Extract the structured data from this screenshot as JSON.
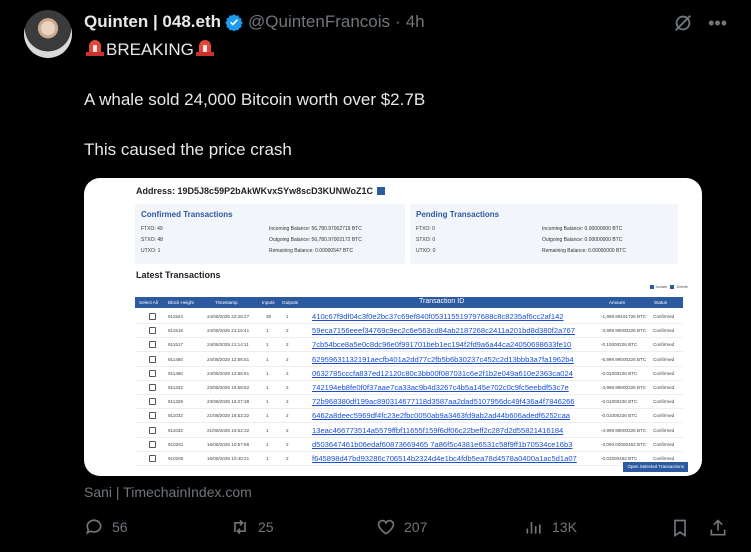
{
  "author": {
    "display_name": "Quinten | 048.eth",
    "handle": "@QuintenFrancois",
    "separator": "·",
    "time": "4h"
  },
  "tweet": {
    "breaking_label": "BREAKING",
    "line1": "A whale sold 24,000 Bitcoin worth over $2.7B",
    "line2": "This caused the price crash",
    "source_caption": "Sani | TimechainIndex.com"
  },
  "embed": {
    "address_label": "Address:",
    "address_value": "19D5J8c59P2bAkWKvxSYw8scD3KUNWoZ1C",
    "confirmed": {
      "title": "Confirmed Transactions",
      "ftxo_label": "FTXO: 49",
      "stxo_label": "STXO: 48",
      "utxo_label": "UTXO: 1",
      "incoming": "Incoming Balance: 56,780.97002719 BTC",
      "outgoing": "Outgoing Balance: 56,780.97002172 BTC",
      "remaining": "Remaining Balance: 0.00000547 BTC"
    },
    "pending": {
      "title": "Pending Transactions",
      "ftxo_label": "FTXO: 0",
      "stxo_label": "STXO: 0",
      "utxo_label": "UTXO: 0",
      "incoming": "Incoming Balance: 0.00000000 BTC",
      "outgoing": "Outgoing Balance: 0.00000000 BTC",
      "remaining": "Remaining Balance: 0.00000000 BTC"
    },
    "latest_title": "Latest Transactions",
    "legend": {
      "isolate": "Isolate",
      "delete": "Delete"
    },
    "columns": [
      "Select All",
      "Block Height",
      "Timestamp",
      "Inputs",
      "Outputs",
      "Transaction ID",
      "Amount",
      "Status"
    ],
    "rows": [
      {
        "block": "911524",
        "time": "24/08/2025 22:26:27",
        "inputs": "38",
        "outputs": "1",
        "txid": "410c67f9df04c3f0e2bc37c69ef840f053115519797688c8c8235af6cc2af142",
        "amount": "-1,968.99191726 BTC",
        "status": "Confirmed"
      },
      {
        "block": "911518",
        "time": "24/08/2025 21:15:41",
        "inputs": "1",
        "outputs": "2",
        "txid": "59eca7156eeef34769c9ec2c6e563cd84ab2187268c2411a201bd8d380f2a767",
        "amount": "-3,999.99000226 BTC",
        "status": "Confirmed"
      },
      {
        "block": "911517",
        "time": "24/08/2025 21:14:11",
        "inputs": "1",
        "outputs": "2",
        "txid": "7cb54bce8a5e0c8dc96e0f991701beb1ec194f2fd9a6a44ca24050698633fe10",
        "amount": "-0.10000226 BTC",
        "status": "Confirmed"
      },
      {
        "block": "911460",
        "time": "24/08/2025 12:56:51",
        "inputs": "1",
        "outputs": "2",
        "txid": "62959631132191aecfb401a2dd77c2fb5b6b30237c452c2d13bbb3a7fa1962b4",
        "amount": "-5,999.99000226 BTC",
        "status": "Confirmed"
      },
      {
        "block": "911460",
        "time": "24/08/2025 12:56:51",
        "inputs": "1",
        "outputs": "2",
        "txid": "0632785cccfa837ed12120c80c3bb00f087031c6e2f1b2e049a610e2363ca024",
        "amount": "-0.01000226 BTC",
        "status": "Confirmed"
      },
      {
        "block": "911332",
        "time": "23/08/2025 16:58:52",
        "inputs": "1",
        "outputs": "2",
        "txid": "742194eb8fe0f0f37aae7ca33ac9b4d3267c4b5a145e702c0c9fc5eebdf53c7e",
        "amount": "-3,999.99000226 BTC",
        "status": "Confirmed"
      },
      {
        "block": "911329",
        "time": "23/08/2025 16:27:38",
        "inputs": "1",
        "outputs": "2",
        "txid": "72b968380df199ac890314677118d3587aa2dad5107956dc49f436a4f7846266",
        "amount": "-0.01000226 BTC",
        "status": "Confirmed"
      },
      {
        "block": "911032",
        "time": "21/08/2025 16:52:32",
        "inputs": "1",
        "outputs": "2",
        "txid": "6462a8deec5969df4fc23e2fbc0050ab9a3463fd9ab2ad44b606adedf6252caa",
        "amount": "-0.01000226 BTC",
        "status": "Confirmed"
      },
      {
        "block": "911032",
        "time": "21/08/2025 16:52:32",
        "inputs": "1",
        "outputs": "2",
        "txid": "13eac466773514a5579ffbf11655f159f6df06c22beff2c287d2d55821416184",
        "amount": "-4,999.99000226 BTC",
        "status": "Confirmed"
      },
      {
        "block": "910261",
        "time": "16/08/2025 10:57:56",
        "inputs": "1",
        "outputs": "2",
        "txid": "d503647461b06edaf60873669465 7a86f5c4381e6531c58f9ff1b70534ce16b3",
        "amount": "-3,000.00000452 BTC",
        "status": "Confirmed"
      },
      {
        "block": "910260",
        "time": "16/08/2025 10:40:21",
        "inputs": "1",
        "outputs": "2",
        "txid": "f645898d47bd93286c706514b2324d4e1bc4fdb5ea78d4578a0400a1ac5d1a07",
        "amount": "-0.01000452 BTC",
        "status": "Confirmed"
      }
    ],
    "open_button": "Open Selected Transactions"
  },
  "actions": {
    "replies": "56",
    "reposts": "25",
    "likes": "207",
    "views": "13K"
  },
  "colors": {
    "background": "#000000",
    "text": "#e7e9ea",
    "muted": "#71767b",
    "verified": "#1d9bf0",
    "table_header": "#2c5aa0",
    "link": "#1a4fd6"
  }
}
